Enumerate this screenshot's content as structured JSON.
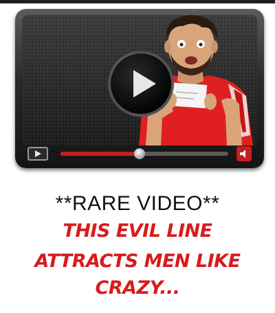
{
  "headline": "**RARE VIDEO**",
  "subtext": {
    "line1": "THIS EVIL LINE",
    "line2": "ATTRACTS MEN LIKE",
    "line3": "CRAZY..."
  },
  "player": {
    "progress": 0.47,
    "icons": [
      "play-icon",
      "control-play-icon",
      "volume-icon"
    ]
  },
  "colors": {
    "accent_red": "#d91b1b",
    "player_dark": "#1b1b1b",
    "shirt_red": "#e02020"
  }
}
